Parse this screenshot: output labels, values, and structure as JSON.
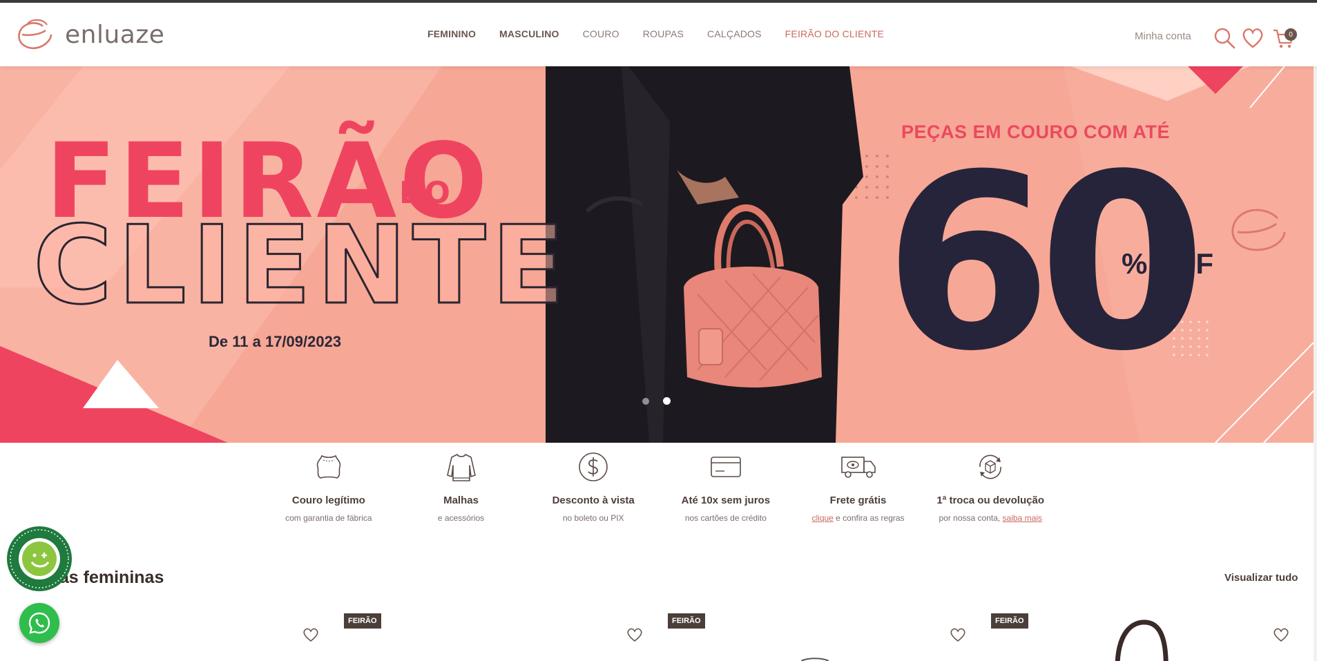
{
  "brand": {
    "name": "enluaze"
  },
  "nav": {
    "items": [
      {
        "label": "FEMININO",
        "style": "bold"
      },
      {
        "label": "MASCULINO",
        "style": "bold"
      },
      {
        "label": "COURO",
        "style": "normal"
      },
      {
        "label": "ROUPAS",
        "style": "normal"
      },
      {
        "label": "CALÇADOS",
        "style": "normal"
      },
      {
        "label": "FEIRÃO DO CLIENTE",
        "style": "highlight"
      }
    ]
  },
  "header": {
    "account_label": "Minha conta",
    "cart_count": "0"
  },
  "hero": {
    "title_line1": "FEIRÃO",
    "title_do": "DO",
    "title_line2": "CLIENTE",
    "date": "De 11 a 17/09/2023",
    "promo": "PEÇAS EM COURO COM ATÉ",
    "big_number": "60",
    "off_label": "% OFF",
    "slides": 2,
    "active_slide": 2
  },
  "benefits": [
    {
      "icon": "leather-icon",
      "title": "Couro legítimo",
      "sub": "com garantia de fábrica"
    },
    {
      "icon": "sweater-icon",
      "title": "Malhas",
      "sub": "e acessórios"
    },
    {
      "icon": "dollar-icon",
      "title": "Desconto à vista",
      "sub": "no boleto ou PIX"
    },
    {
      "icon": "credit-card-icon",
      "title": "Até 10x sem juros",
      "sub": "nos cartões de crédito"
    },
    {
      "icon": "truck-icon",
      "title": "Frete grátis",
      "sub_link": "clique",
      "sub_rest": " e confira as regras"
    },
    {
      "icon": "exchange-icon",
      "title": "1ª troca ou devolução",
      "sub_pre": "por nossa conta, ",
      "sub_link": "saiba mais"
    }
  ],
  "section": {
    "title": "Bolsas femininas",
    "title_visible": "ilas femininas",
    "view_all": "Visualizar tudo"
  },
  "products": [
    {
      "badge": "FEIRÃO"
    },
    {
      "badge": "FEIRÃO"
    },
    {
      "badge": "FEIRÃO"
    }
  ],
  "colors": {
    "accent": "#c96a5e",
    "hero_bg": "#f7a795",
    "hero_red": "#ef4460",
    "dark": "#26243a",
    "whatsapp": "#2fbd4b"
  }
}
